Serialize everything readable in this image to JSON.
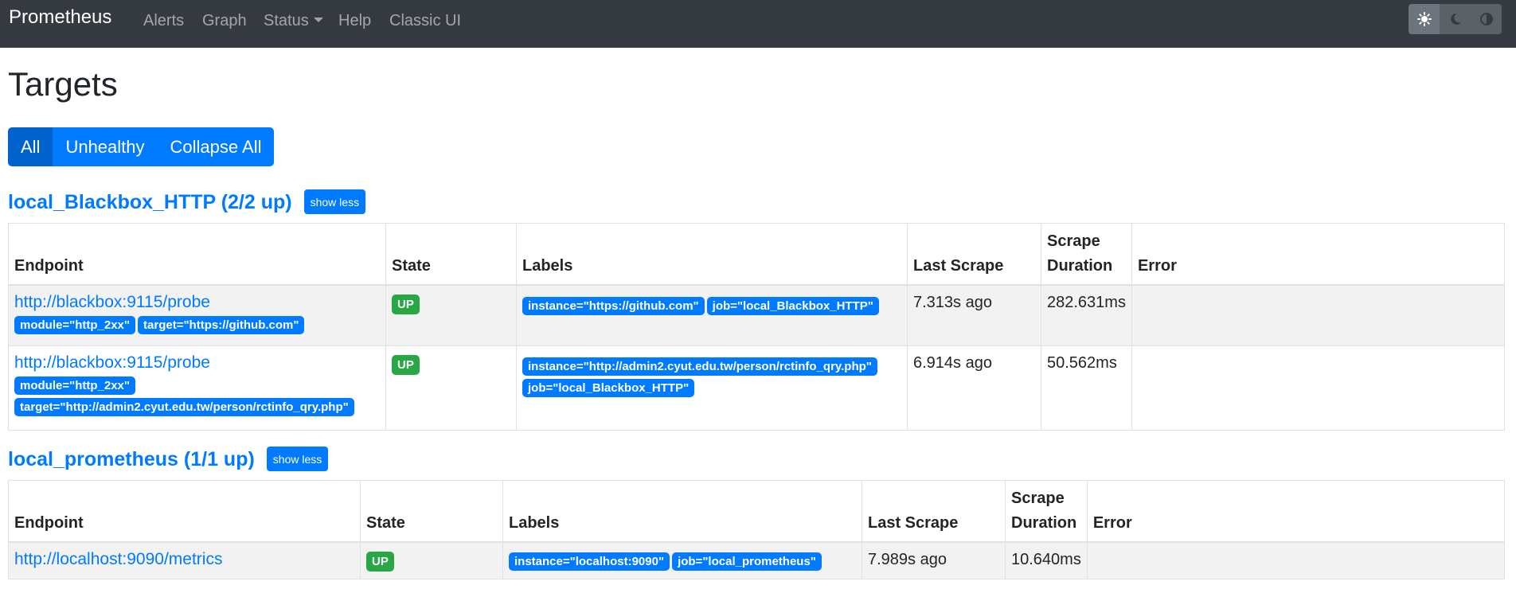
{
  "nav": {
    "brand": "Prometheus",
    "links": {
      "alerts": "Alerts",
      "graph": "Graph",
      "status": "Status",
      "help": "Help",
      "classic": "Classic UI"
    },
    "theme_icons": [
      "sun-icon",
      "moon-icon",
      "half-circle-icon"
    ]
  },
  "page": {
    "title": "Targets",
    "filters": {
      "all": "All",
      "unhealthy": "Unhealthy",
      "collapse": "Collapse All"
    }
  },
  "columns": {
    "endpoint": "Endpoint",
    "state": "State",
    "labels": "Labels",
    "last_scrape": "Last Scrape",
    "scrape_duration_1": "Scrape",
    "scrape_duration_2": "Duration",
    "error": "Error"
  },
  "jobs": [
    {
      "title": "local_Blackbox_HTTP (2/2 up)",
      "toggle": "show less",
      "rows": [
        {
          "endpoint": "http://blackbox:9115/probe",
          "endpoint_labels": [
            "module=\"http_2xx\"",
            "target=\"https://github.com\""
          ],
          "state": "UP",
          "labels": [
            "instance=\"https://github.com\"",
            "job=\"local_Blackbox_HTTP\""
          ],
          "last_scrape": "7.313s ago",
          "scrape_duration": "282.631ms",
          "error": ""
        },
        {
          "endpoint": "http://blackbox:9115/probe",
          "endpoint_labels": [
            "module=\"http_2xx\"",
            "target=\"http://admin2.cyut.edu.tw/person/rctinfo_qry.php\""
          ],
          "state": "UP",
          "labels": [
            "instance=\"http://admin2.cyut.edu.tw/person/rctinfo_qry.php\"",
            "job=\"local_Blackbox_HTTP\""
          ],
          "last_scrape": "6.914s ago",
          "scrape_duration": "50.562ms",
          "error": ""
        }
      ]
    },
    {
      "title": "local_prometheus (1/1 up)",
      "toggle": "show less",
      "rows": [
        {
          "endpoint": "http://localhost:9090/metrics",
          "endpoint_labels": [],
          "state": "UP",
          "labels": [
            "instance=\"localhost:9090\"",
            "job=\"local_prometheus\""
          ],
          "last_scrape": "7.989s ago",
          "scrape_duration": "10.640ms",
          "error": ""
        }
      ]
    }
  ],
  "colors": {
    "navbar": "#343a40",
    "primary": "#007bff",
    "success": "#28a745"
  }
}
